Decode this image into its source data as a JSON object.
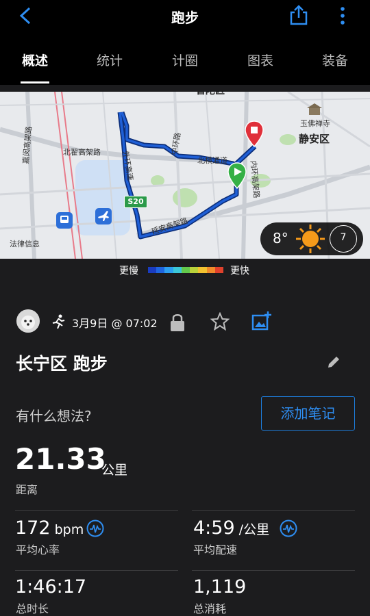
{
  "header": {
    "title": "跑步"
  },
  "tabs": [
    "概述",
    "统计",
    "计圈",
    "图表",
    "装备"
  ],
  "map": {
    "labels": {
      "jingan": "静安区",
      "putuo": "普陀区",
      "temple": "玉佛禅寺",
      "beizhai": "北翟高架路",
      "beiheng": "北横通道",
      "yanan": "延安高架路",
      "waihuan": "外环高速",
      "zhonghuan": "中环路",
      "neihuan": "内环高架路",
      "jiaoding": "嘉闵高架路",
      "s20": "S20",
      "legal": "法律信息"
    },
    "weather": {
      "temp": "8°",
      "wind": "7"
    }
  },
  "legend": {
    "slower": "更慢",
    "faster": "更快",
    "colors": [
      "#1a3cc0",
      "#1f66e0",
      "#2da0f0",
      "#3bc7d8",
      "#63c94b",
      "#b9d23a",
      "#f2c230",
      "#f08a2a",
      "#e0412c"
    ]
  },
  "activity": {
    "date": "3月9日 @ 07:02",
    "title": "长宁区 跑步",
    "thoughts_placeholder": "有什么想法?",
    "add_note": "添加笔记"
  },
  "stats": {
    "distance": {
      "value": "21.33",
      "unit": "公里",
      "label": "距离"
    },
    "heart_rate": {
      "value": "172",
      "unit": " bpm",
      "label": "平均心率"
    },
    "pace": {
      "value": "4:59",
      "unit": " /公里",
      "label": "平均配速"
    },
    "duration": {
      "value": "1:46:17",
      "label": "总时长"
    },
    "calories": {
      "value": "1,119",
      "label": "总消耗"
    }
  },
  "colors": {
    "accent": "#2e8ef2",
    "start": "#35b046",
    "end": "#e0303a",
    "route": "#1f4fb8"
  }
}
